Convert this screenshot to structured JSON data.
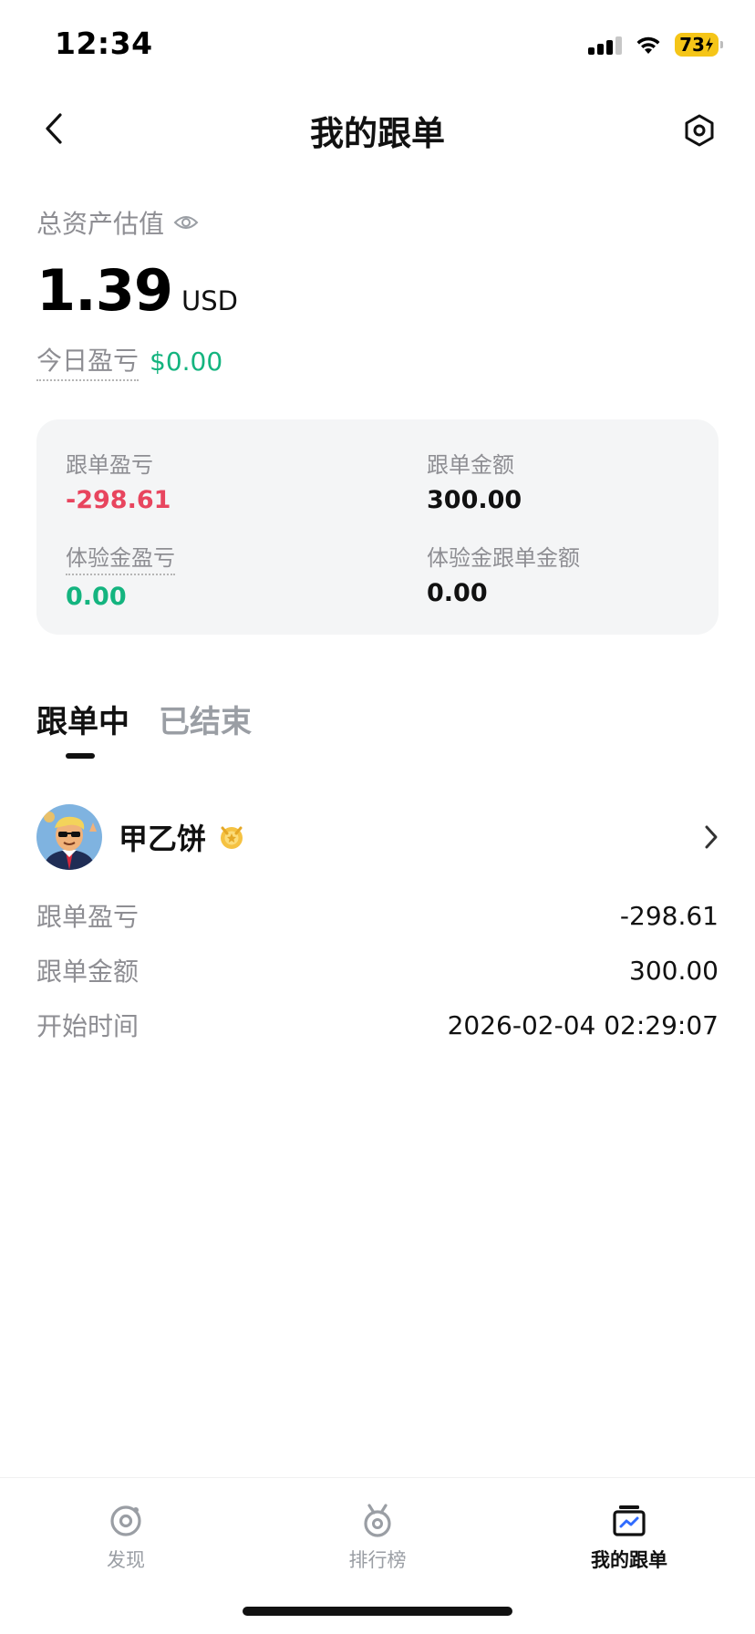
{
  "status_bar": {
    "time": "12:34",
    "battery": "73"
  },
  "header": {
    "title": "我的跟单"
  },
  "asset": {
    "label": "总资产估值",
    "value": "1.39",
    "unit": "USD",
    "today_label": "今日盈亏",
    "today_value": "$0.00"
  },
  "summary": {
    "follow_pnl_label": "跟单盈亏",
    "follow_pnl_value": "-298.61",
    "follow_amount_label": "跟单金额",
    "follow_amount_value": "300.00",
    "trial_pnl_label": "体验金盈亏",
    "trial_pnl_value": "0.00",
    "trial_amount_label": "体验金跟单金额",
    "trial_amount_value": "0.00"
  },
  "tabs": [
    {
      "label": "跟单中",
      "active": true
    },
    {
      "label": "已结束",
      "active": false
    }
  ],
  "position": {
    "trader_name": "甲乙饼",
    "rows": [
      {
        "label": "跟单盈亏",
        "value": "-298.61"
      },
      {
        "label": "跟单金额",
        "value": "300.00"
      },
      {
        "label": "开始时间",
        "value": "2026-02-04 02:29:07"
      }
    ]
  },
  "bottom_nav": [
    {
      "label": "发现",
      "icon": "discover-icon",
      "active": false
    },
    {
      "label": "排行榜",
      "icon": "leaderboard-icon",
      "active": false
    },
    {
      "label": "我的跟单",
      "icon": "my-copytrade-icon",
      "active": true
    }
  ],
  "colors": {
    "negative": "#e8455e",
    "positive": "#14b47f",
    "battery": "#f5c518"
  }
}
